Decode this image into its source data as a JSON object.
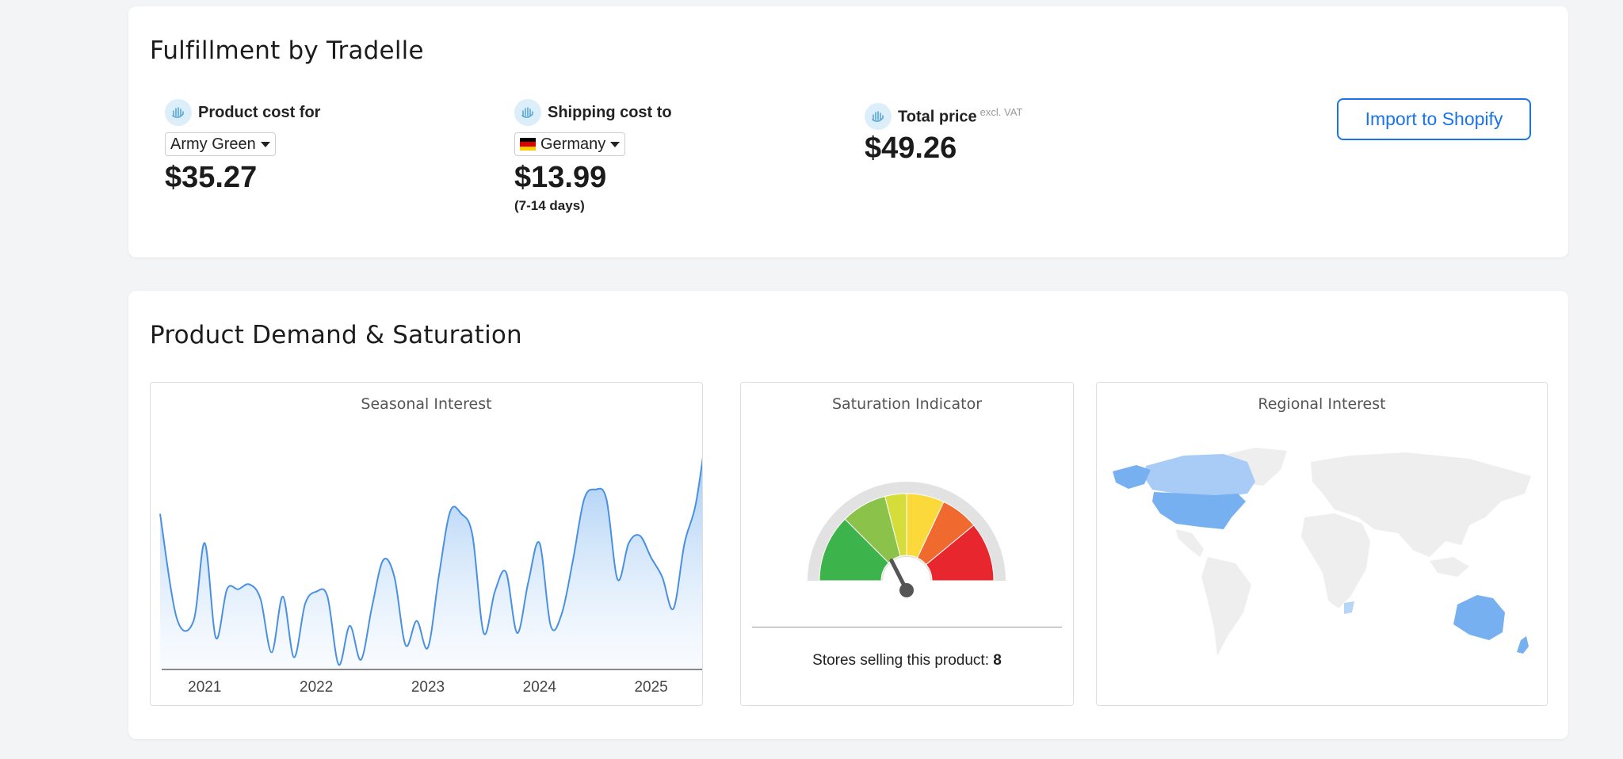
{
  "fulfillment": {
    "title": "Fulfillment by Tradelle",
    "product_cost": {
      "label": "Product cost for",
      "variant": "Army Green",
      "price": "$35.27"
    },
    "shipping_cost": {
      "label": "Shipping cost to",
      "country": "Germany",
      "price": "$13.99",
      "days": "(7-14 days)"
    },
    "total": {
      "label": "Total price",
      "sup": "excl. VAT",
      "price": "$49.26"
    },
    "import_button": "Import to Shopify",
    "icon": "tradelle-hand-icon",
    "accent_color": "#1a73e8"
  },
  "demand": {
    "title": "Product Demand & Saturation",
    "seasonal_title": "Seasonal Interest",
    "saturation_title": "Saturation Indicator",
    "regional_title": "Regional Interest",
    "stores_label": "Stores selling this product:",
    "stores_count": "8",
    "saturation_level": 0.35,
    "regions_highlighted": [
      "United States",
      "Canada",
      "Alaska",
      "Australia",
      "New Zealand"
    ]
  },
  "chart_data": {
    "type": "area",
    "title": "Seasonal Interest",
    "xlabel": "",
    "ylabel": "",
    "x_ticks": [
      "2021",
      "2022",
      "2023",
      "2024",
      "2025"
    ],
    "x": [
      2020.6,
      2020.75,
      2020.9,
      2021.0,
      2021.1,
      2021.2,
      2021.3,
      2021.4,
      2021.5,
      2021.6,
      2021.7,
      2021.8,
      2021.9,
      2022.0,
      2022.1,
      2022.2,
      2022.3,
      2022.4,
      2022.5,
      2022.6,
      2022.7,
      2022.8,
      2022.9,
      2023.0,
      2023.1,
      2023.2,
      2023.3,
      2023.4,
      2023.5,
      2023.6,
      2023.7,
      2023.8,
      2023.9,
      2024.0,
      2024.1,
      2024.2,
      2024.3,
      2024.4,
      2024.5,
      2024.6,
      2024.7,
      2024.8,
      2024.9,
      2025.0,
      2025.1,
      2025.2,
      2025.3,
      2025.4,
      2025.5
    ],
    "values": [
      64,
      21,
      20,
      52,
      13,
      33,
      33,
      35,
      29,
      7,
      30,
      5,
      27,
      32,
      30,
      2,
      18,
      4,
      26,
      45,
      38,
      10,
      20,
      9,
      39,
      65,
      64,
      55,
      15,
      32,
      40,
      15,
      36,
      52,
      18,
      23,
      45,
      70,
      74,
      70,
      37,
      52,
      55,
      46,
      38,
      25,
      52,
      68,
      99
    ],
    "ylim": [
      0,
      100
    ],
    "grid": false,
    "color": "#4a90e2"
  }
}
